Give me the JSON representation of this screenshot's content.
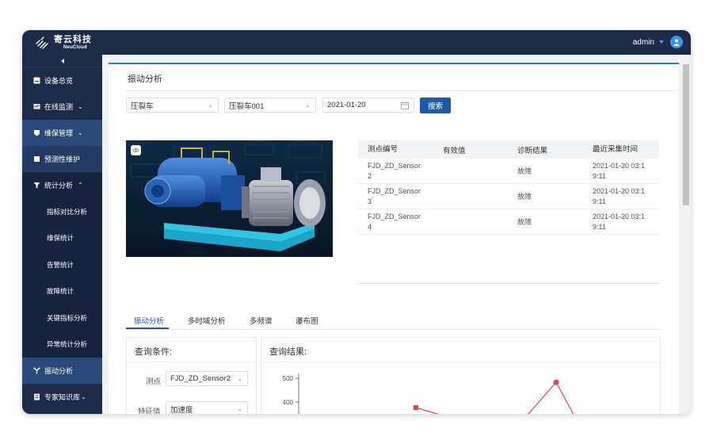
{
  "topbar": {
    "brand_cn": "寄云科技",
    "brand_en": "NeuCloud",
    "user": "admin"
  },
  "sidebar": {
    "items": [
      {
        "label": "设备总览",
        "icon": "dashboard-icon"
      },
      {
        "label": "在线监测",
        "icon": "monitor-icon",
        "chevron": "⌄"
      },
      {
        "label": "维保管理",
        "icon": "maintenance-icon",
        "chevron": "⌄"
      },
      {
        "label": "预测性维护",
        "icon": "predict-icon"
      },
      {
        "label": "统计分析",
        "icon": "filter-icon",
        "chevron": "⌃"
      },
      {
        "label": "指标对比分析"
      },
      {
        "label": "维保统计"
      },
      {
        "label": "告警统计"
      },
      {
        "label": "故障统计"
      },
      {
        "label": "关键指标分析"
      },
      {
        "label": "异常统计分析"
      },
      {
        "label": "振动分析",
        "icon": "vibration-icon"
      },
      {
        "label": "专家知识库",
        "icon": "knowledge-icon",
        "chevron": "⌄"
      }
    ]
  },
  "page": {
    "title": "振动分析"
  },
  "filters": {
    "device_type": "压裂车",
    "device": "压裂车001",
    "date": "2021-01-20",
    "search_label": "搜索"
  },
  "table": {
    "headers": [
      "测点编号",
      "有效值",
      "诊断结果",
      "最近采集时间"
    ],
    "rows": [
      {
        "id_line1": "FJD_ZD_Sensor",
        "id_line2": "2",
        "value": "",
        "result": "故障",
        "time_line1": "2021-01-20 03:1",
        "time_line2": "9:11"
      },
      {
        "id_line1": "FJD_ZD_Sensor",
        "id_line2": "3",
        "value": "",
        "result": "故障",
        "time_line1": "2021-01-20 03:1",
        "time_line2": "9:11"
      },
      {
        "id_line1": "FJD_ZD_Sensor",
        "id_line2": "4",
        "value": "",
        "result": "故障",
        "time_line1": "2021-01-20 03:1",
        "time_line2": "9:11"
      }
    ]
  },
  "tabs": [
    "振动分析",
    "多时域分析",
    "多频谱",
    "瀑布图"
  ],
  "query": {
    "title": "查询条件:",
    "point_label": "测点",
    "point_value": "FJD_ZD_Sensor2",
    "feature_label": "特征值",
    "feature_value": "加速度"
  },
  "result": {
    "title": "查询结果:"
  },
  "chart_data": {
    "type": "line",
    "y_ticks": [
      "500",
      "400"
    ],
    "series_color": "#e8434a",
    "note": "partially visible line chart"
  }
}
